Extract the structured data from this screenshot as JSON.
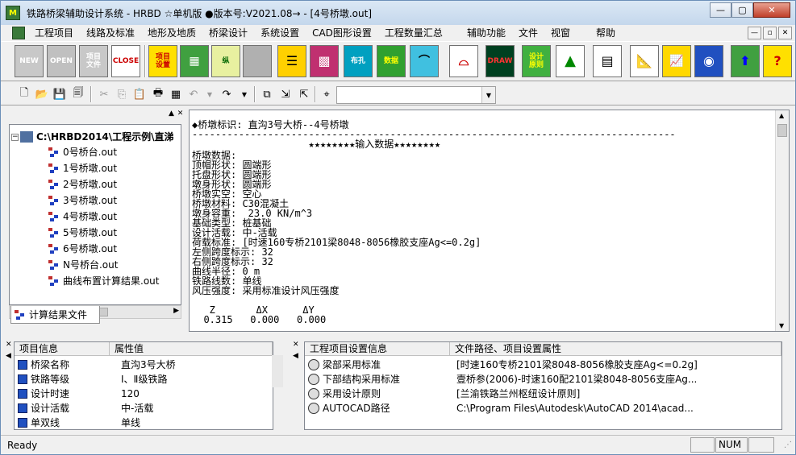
{
  "window": {
    "title": "铁路桥梁辅助设计系统 - HRBD  ☆单机版 ●版本号:V2021.08→ - [4号桥墩.out]",
    "min": "—",
    "max": "▢",
    "close": "✕"
  },
  "menu": {
    "items": [
      "工程项目",
      "线路及标准",
      "地形及地质",
      "桥梁设计",
      "系统设置",
      "CAD图形设置",
      "工程数量汇总",
      "辅助功能",
      "文件",
      "视窗",
      "帮助"
    ],
    "mdi": [
      "—",
      "▫",
      "✕"
    ]
  },
  "toolbar_big": {
    "new": "NEW",
    "open": "OPEN",
    "project": "项目\n文件",
    "close": "CLOSE",
    "setting": "项目\n设置",
    "zong": "纵",
    "ping": "平",
    "buzhi": "布孔",
    "shuju": "数据",
    "draw": "DRAW",
    "yuanze": "设计\n原则"
  },
  "combo": {
    "value": ""
  },
  "tree": {
    "root": "C:\\HRBD2014\\工程示例\\直涕",
    "items": [
      "0号桥台.out",
      "1号桥墩.out",
      "2号桥墩.out",
      "3号桥墩.out",
      "4号桥墩.out",
      "5号桥墩.out",
      "6号桥墩.out",
      "N号桥台.out",
      "曲线布置计算结果.out"
    ]
  },
  "tab": {
    "label": "计算结果文件"
  },
  "output": {
    "lines": [
      "◆桥墩标识: 直沟3号大桥--4号桥墩",
      "-----------------------------------------------------------------------------------",
      "                    ★★★★★★★★输入数据★★★★★★★★",
      "桥墩数据:",
      "顶帽形状: 圆端形",
      "托盘形状: 圆端形",
      "墩身形状: 圆端形",
      "桥墩实空: 空心",
      "桥墩材料: C30混凝土",
      "墩身容重:  23.0 KN/m^3",
      "基础类型: 桩基础",
      "设计活载: 中-活载",
      "荷载标准: [时速160专桥2101梁8048-8056橡胶支座Ag<=0.2g]",
      "左侧跨度标示: 32",
      "右侧跨度标示: 32",
      "曲线半径: 0 m",
      "铁路线数: 单线",
      "风压强度: 采用标准设计风压强度",
      "",
      "   Z       ΔX      ΔY",
      "  0.315   0.000   0.000"
    ]
  },
  "props": {
    "headers": [
      "项目信息",
      "属性值"
    ],
    "rows": [
      {
        "k": "桥梁名称",
        "v": "直沟3号大桥"
      },
      {
        "k": "铁路等级",
        "v": "Ⅰ、Ⅱ级铁路"
      },
      {
        "k": "设计时速",
        "v": "120"
      },
      {
        "k": "设计活载",
        "v": "中-活载"
      },
      {
        "k": "单双线",
        "v": "单线"
      }
    ]
  },
  "config": {
    "headers": [
      "工程项目设置信息",
      "文件路径、项目设置属性"
    ],
    "rows": [
      {
        "k": "梁部采用标准",
        "v": "[时速160专桥2101梁8048-8056橡胶支座Ag<=0.2g]"
      },
      {
        "k": "下部结构采用标准",
        "v": "壹桥参(2006)-时速160配2101梁8048-8056支座Ag..."
      },
      {
        "k": "采用设计原则",
        "v": "[兰渝铁路兰州枢纽设计原则]"
      },
      {
        "k": "AUTOCAD路径",
        "v": "C:\\Program Files\\Autodesk\\AutoCAD 2014\\acad..."
      }
    ]
  },
  "status": {
    "text": "Ready",
    "num": "NUM"
  },
  "colors": {
    "titlebar": "#c4d7ec",
    "accent": "#2050c0"
  }
}
